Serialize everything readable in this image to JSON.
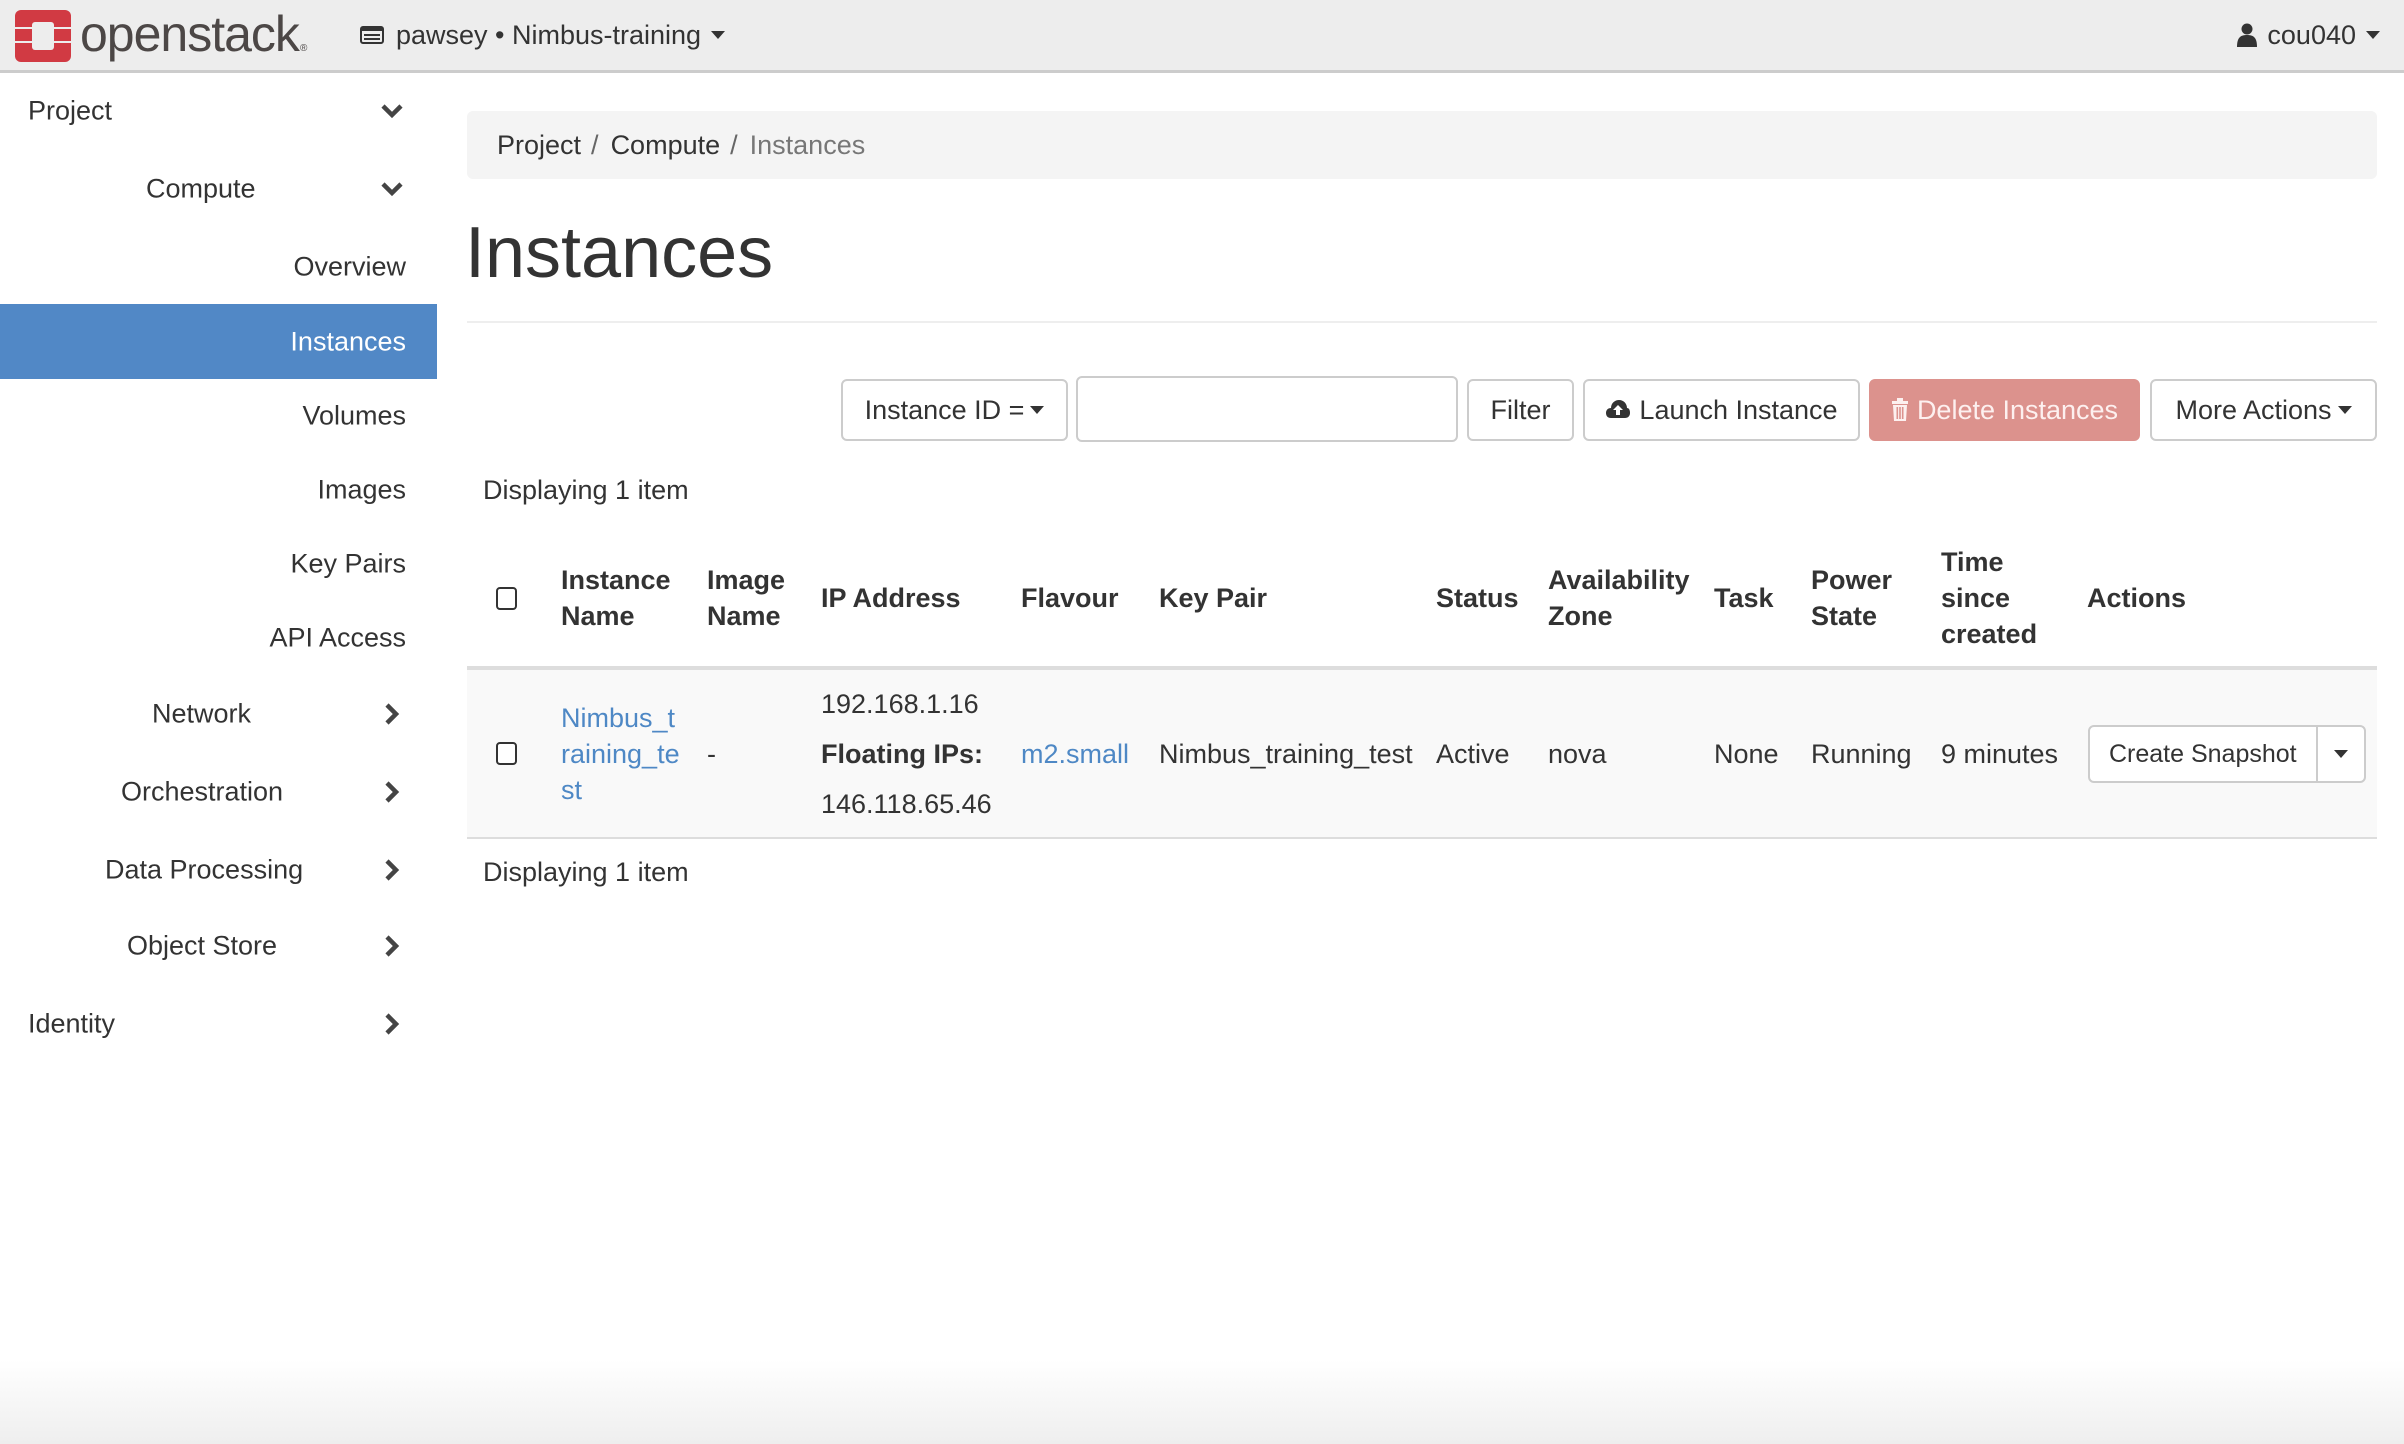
{
  "header": {
    "brand": "openstack",
    "brand_registered": "®",
    "project_icon": "project-list-icon",
    "project_switcher": "pawsey • Nimbus-training",
    "user_icon": "user-icon",
    "username": "cou040",
    "brand_color": "#d13a43"
  },
  "sidebar": {
    "active_color": "#5188c6",
    "items": [
      {
        "label": "Project",
        "level": 0,
        "icon": "chevron-down-icon"
      },
      {
        "label": "Compute",
        "level": 1,
        "icon": "chevron-down-icon"
      },
      {
        "label": "Overview",
        "level": 2
      },
      {
        "label": "Instances",
        "level": 2,
        "active": true
      },
      {
        "label": "Volumes",
        "level": 2
      },
      {
        "label": "Images",
        "level": 2
      },
      {
        "label": "Key Pairs",
        "level": 2
      },
      {
        "label": "API Access",
        "level": 2
      },
      {
        "label": "Network",
        "level": 1,
        "icon": "chevron-right-icon"
      },
      {
        "label": "Orchestration",
        "level": 1,
        "icon": "chevron-right-icon"
      },
      {
        "label": "Data Processing",
        "level": 1,
        "icon": "chevron-right-icon"
      },
      {
        "label": "Object Store",
        "level": 1,
        "icon": "chevron-right-icon"
      },
      {
        "label": "Identity",
        "level": 0,
        "icon": "chevron-right-icon"
      }
    ]
  },
  "breadcrumb": [
    "Project",
    "Compute",
    "Instances"
  ],
  "breadcrumb_separator": "/",
  "page_title": "Instances",
  "toolbar": {
    "filter_field": "Instance ID =",
    "filter_value": "",
    "filter_placeholder": "",
    "filter_button": "Filter",
    "launch_button": "Launch Instance",
    "launch_icon": "cloud-upload-icon",
    "delete_button": "Delete Instances",
    "delete_icon": "trash-icon",
    "delete_color": "#dc928d",
    "more_button": "More Actions"
  },
  "table": {
    "count_top": "Displaying 1 item",
    "count_bottom": "Displaying 1 item",
    "columns": [
      [
        "Instance",
        "Name"
      ],
      [
        "Image",
        "Name"
      ],
      [
        "IP Address"
      ],
      [
        "Flavour"
      ],
      [
        "Key Pair"
      ],
      [
        "Status"
      ],
      [
        "Availability",
        "Zone"
      ],
      [
        "Task"
      ],
      [
        "Power",
        "State"
      ],
      [
        "Time",
        "since",
        "created"
      ],
      [
        "Actions"
      ]
    ],
    "rows": [
      {
        "checked": false,
        "instance_name_lines": [
          "Nimbus_t",
          "raining_te",
          "st"
        ],
        "instance_name": "Nimbus_training_test",
        "image_name": "-",
        "ip_address": "192.168.1.16",
        "floating_label": "Floating IPs:",
        "floating_ip": "146.118.65.46",
        "flavour": "m2.small",
        "key_pair": "Nimbus_training_test",
        "status": "Active",
        "availability_zone": "nova",
        "task": "None",
        "power_state": "Running",
        "time_since_created": "9 minutes",
        "action_button": "Create Snapshot"
      }
    ]
  }
}
